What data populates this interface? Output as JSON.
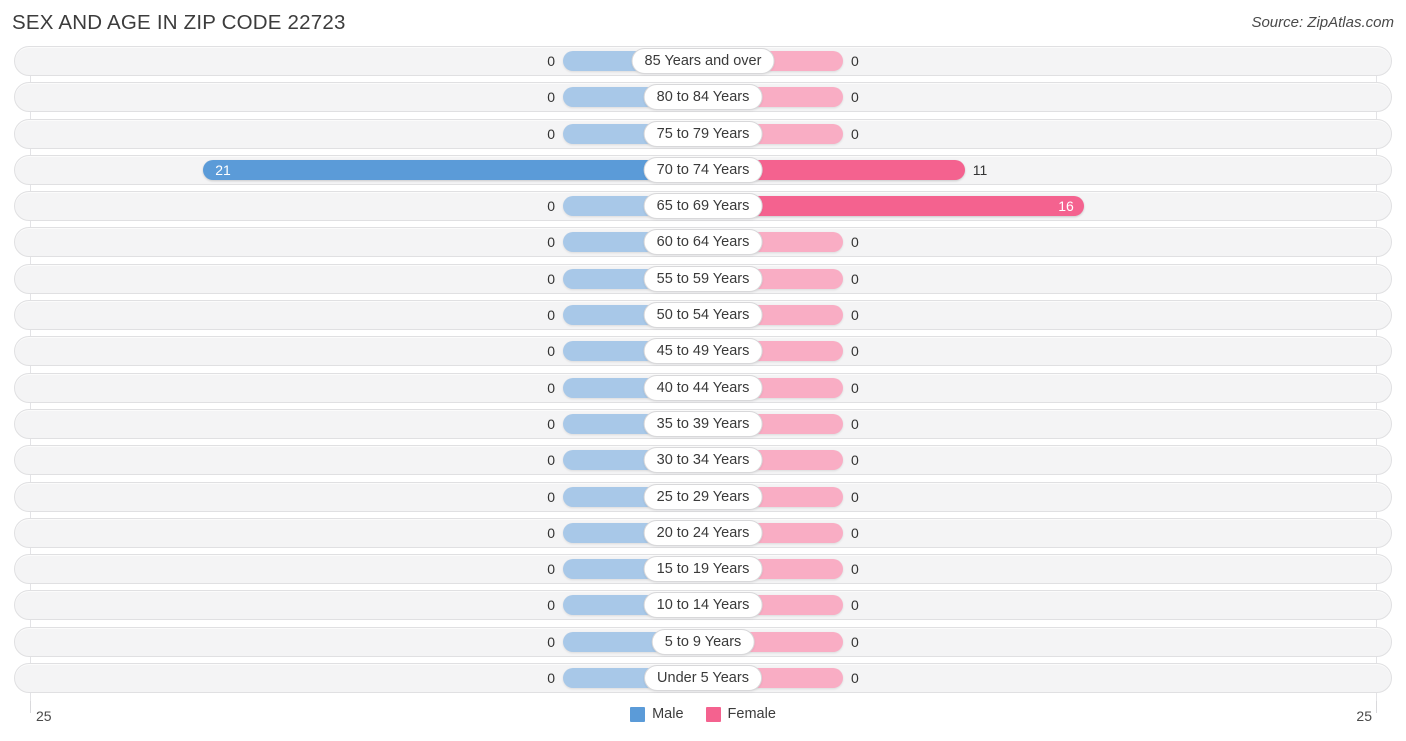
{
  "header": {
    "title": "SEX AND AGE IN ZIP CODE 22723",
    "source": "Source: ZipAtlas.com"
  },
  "axis": {
    "left_label": "25",
    "right_label": "25",
    "max": 25
  },
  "legend": {
    "items": [
      {
        "label": "Male",
        "color": "#5b9bd8"
      },
      {
        "label": "Female",
        "color": "#f4628f"
      }
    ]
  },
  "colors": {
    "male": "#5b9bd8",
    "female": "#f4628f",
    "male_zero": "#a8c8e8",
    "female_zero": "#f9adc4",
    "track": "#f4f4f5",
    "track_border": "#e0e0e2",
    "gridline": "#e3e3e6"
  },
  "chart_data": {
    "type": "bar",
    "title": "SEX AND AGE IN ZIP CODE 22723",
    "subtitle": "",
    "xlabel": "",
    "ylabel": "",
    "orientation": "horizontal",
    "layout": "population-pyramid",
    "grid": true,
    "legend_position": "bottom-center",
    "xlim": [
      25,
      25
    ],
    "categories": [
      "85 Years and over",
      "80 to 84 Years",
      "75 to 79 Years",
      "70 to 74 Years",
      "65 to 69 Years",
      "60 to 64 Years",
      "55 to 59 Years",
      "50 to 54 Years",
      "45 to 49 Years",
      "40 to 44 Years",
      "35 to 39 Years",
      "30 to 34 Years",
      "25 to 29 Years",
      "20 to 24 Years",
      "15 to 19 Years",
      "10 to 14 Years",
      "5 to 9 Years",
      "Under 5 Years"
    ],
    "series": [
      {
        "name": "Male",
        "side": "left",
        "color": "#5b9bd8",
        "values": [
          0,
          0,
          0,
          21,
          0,
          0,
          0,
          0,
          0,
          0,
          0,
          0,
          0,
          0,
          0,
          0,
          0,
          0
        ]
      },
      {
        "name": "Female",
        "side": "right",
        "color": "#f4628f",
        "values": [
          0,
          0,
          0,
          11,
          16,
          0,
          0,
          0,
          0,
          0,
          0,
          0,
          0,
          0,
          0,
          0,
          0,
          0
        ]
      }
    ],
    "rows": [
      {
        "label": "85 Years and over",
        "male": 0,
        "female": 0
      },
      {
        "label": "80 to 84 Years",
        "male": 0,
        "female": 0
      },
      {
        "label": "75 to 79 Years",
        "male": 0,
        "female": 0
      },
      {
        "label": "70 to 74 Years",
        "male": 21,
        "female": 11
      },
      {
        "label": "65 to 69 Years",
        "male": 0,
        "female": 16
      },
      {
        "label": "60 to 64 Years",
        "male": 0,
        "female": 0
      },
      {
        "label": "55 to 59 Years",
        "male": 0,
        "female": 0
      },
      {
        "label": "50 to 54 Years",
        "male": 0,
        "female": 0
      },
      {
        "label": "45 to 49 Years",
        "male": 0,
        "female": 0
      },
      {
        "label": "40 to 44 Years",
        "male": 0,
        "female": 0
      },
      {
        "label": "35 to 39 Years",
        "male": 0,
        "female": 0
      },
      {
        "label": "30 to 34 Years",
        "male": 0,
        "female": 0
      },
      {
        "label": "25 to 29 Years",
        "male": 0,
        "female": 0
      },
      {
        "label": "20 to 24 Years",
        "male": 0,
        "female": 0
      },
      {
        "label": "15 to 19 Years",
        "male": 0,
        "female": 0
      },
      {
        "label": "10 to 14 Years",
        "male": 0,
        "female": 0
      },
      {
        "label": "5 to 9 Years",
        "male": 0,
        "female": 0
      },
      {
        "label": "Under 5 Years",
        "male": 0,
        "female": 0
      }
    ]
  }
}
